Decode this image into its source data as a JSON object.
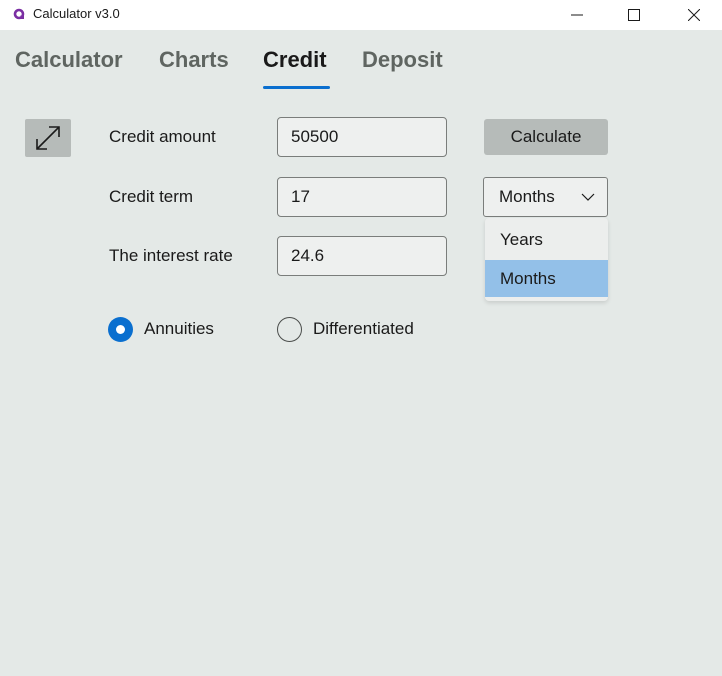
{
  "window": {
    "title": "Calculator v3.0",
    "icon": "app-logo-icon",
    "controls": [
      "minimize-icon",
      "maximize-icon",
      "close-icon"
    ]
  },
  "tabs": [
    {
      "label": "Calculator",
      "active": false
    },
    {
      "label": "Charts",
      "active": false
    },
    {
      "label": "Credit",
      "active": true
    },
    {
      "label": "Deposit",
      "active": false
    }
  ],
  "form": {
    "expand_icon": "expand-arrows-icon",
    "credit_amount": {
      "label": "Credit amount",
      "value": "50500"
    },
    "credit_term": {
      "label": "Credit term",
      "value": "17"
    },
    "interest_rate": {
      "label": "The interest rate",
      "value": "24.6"
    },
    "calculate_label": "Calculate",
    "term_unit": {
      "selected": "Months",
      "options": [
        "Years",
        "Months"
      ],
      "highlighted": "Months"
    },
    "payment_type": {
      "options": [
        {
          "label": "Annuities",
          "checked": true
        },
        {
          "label": "Differentiated",
          "checked": false
        }
      ]
    }
  },
  "colors": {
    "accent": "#0a6fcf",
    "background": "#e4e9e7",
    "highlight": "#93c0e8",
    "app_icon": "#7b2fa3"
  }
}
